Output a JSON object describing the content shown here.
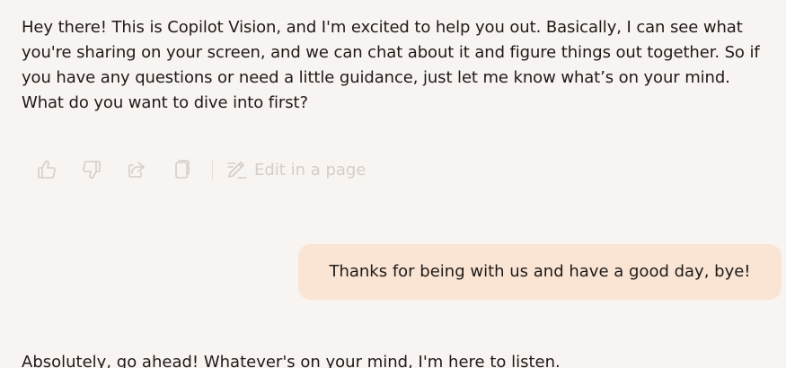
{
  "messages": {
    "assistant_first": "Hey there! This is Copilot Vision, and I'm excited to help you out. Basically, I can see what you're sharing on your screen, and we can chat about it and figure things out together. So if you have any questions or need a little guidance, just let me know what’s on your mind. What do you want to dive into first?",
    "user": "Thanks for being with us and have a good day, bye!",
    "assistant_second": "Absolutely, go ahead! Whatever's on your mind, I'm here to listen."
  },
  "actions": {
    "icons": [
      "thumbs-up-icon",
      "thumbs-down-icon",
      "share-icon",
      "copy-icon",
      "edit-page-icon"
    ],
    "edit_label": "Edit in a page"
  },
  "colors": {
    "background": "#f8f4f1",
    "user_bubble": "#fae5d5",
    "action_icons": "#d4cec9",
    "text": "#1f1a17"
  }
}
